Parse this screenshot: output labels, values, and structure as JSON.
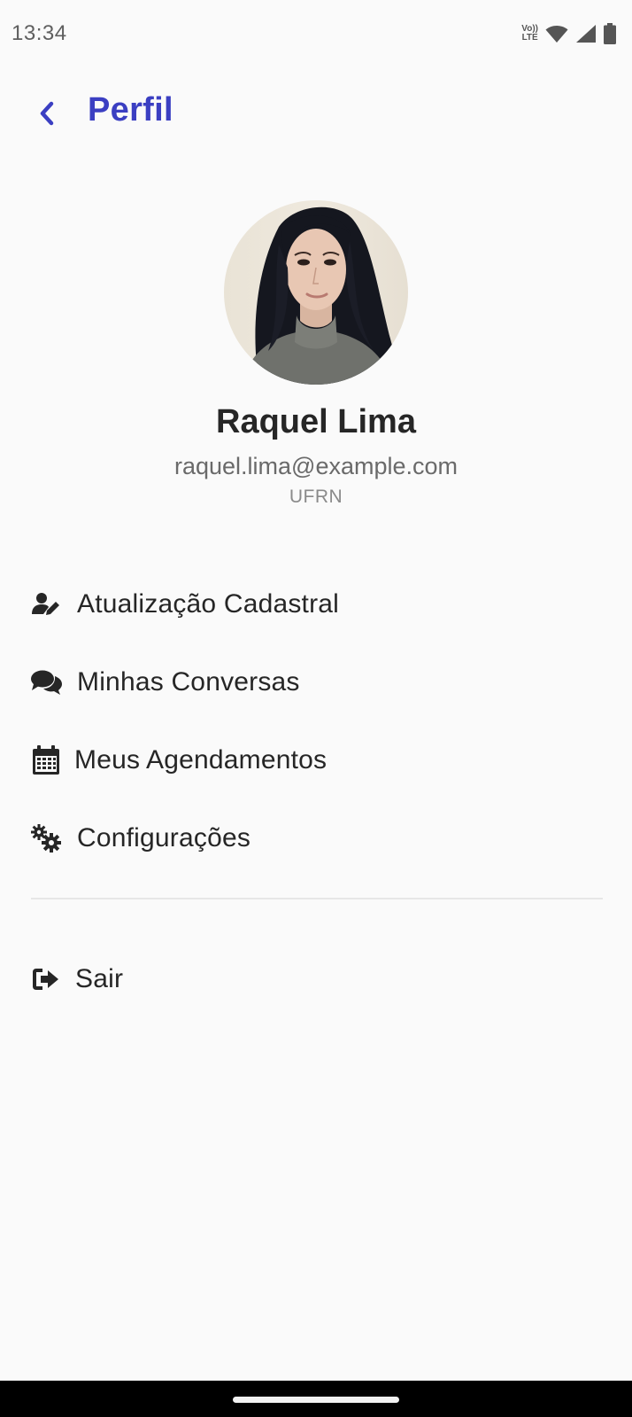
{
  "status_bar": {
    "time": "13:34",
    "volte_top": "Vo))",
    "volte_bottom": "LTE",
    "icons": [
      "wifi-icon",
      "signal-icon",
      "battery-icon"
    ]
  },
  "header": {
    "back_icon": "chevron-left-icon",
    "title": "Perfil"
  },
  "profile": {
    "avatar": "profile-photo",
    "name": "Raquel Lima",
    "email": "raquel.lima@example.com",
    "organization": "UFRN"
  },
  "menu": {
    "items": [
      {
        "icon": "user-edit-icon",
        "label": "Atualização Cadastral"
      },
      {
        "icon": "comments-icon",
        "label": "Minhas Conversas"
      },
      {
        "icon": "calendar-icon",
        "label": "Meus Agendamentos"
      },
      {
        "icon": "cogs-icon",
        "label": "Configurações"
      }
    ],
    "logout": {
      "icon": "sign-out-icon",
      "label": "Sair"
    }
  },
  "colors": {
    "accent": "#3b3fc2",
    "background": "#fafafa",
    "text": "#262626",
    "muted": "#6a6a6a"
  }
}
